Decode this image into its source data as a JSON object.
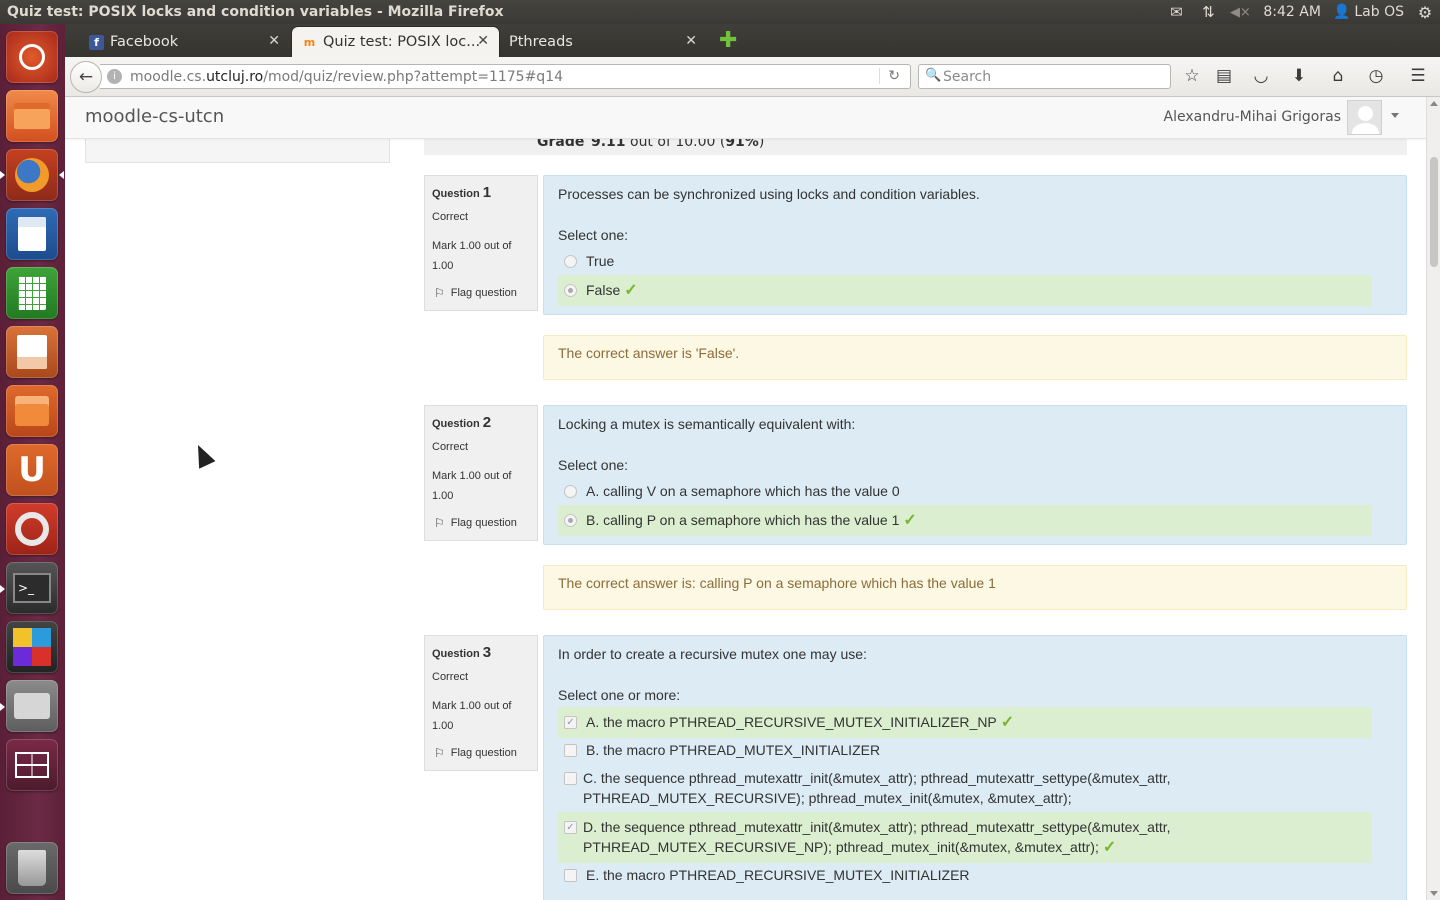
{
  "window": {
    "title": "Quiz test: POSIX locks and condition variables - Mozilla Firefox"
  },
  "system": {
    "clock": "8:42 AM",
    "user": "Lab OS",
    "icons": [
      "mail-icon",
      "network-icon",
      "volume-muted-icon",
      "gear-icon"
    ]
  },
  "launcher": {
    "items": [
      "ubuntu-dash",
      "files",
      "firefox",
      "libreoffice-writer",
      "libreoffice-calc",
      "libreoffice-impress",
      "software-center",
      "ubuntu-one",
      "system-settings",
      "terminal",
      "color-app",
      "printer-app",
      "workspace-switcher",
      "trash"
    ]
  },
  "tabs": [
    {
      "label": "Facebook",
      "favicon": "facebook-icon"
    },
    {
      "label": "Quiz test: POSIX loc...",
      "favicon": "moodle-icon"
    },
    {
      "label": "Pthreads",
      "favicon": ""
    }
  ],
  "urlbar": {
    "prefix": "moodle.cs.",
    "domain": "utcluj.ro",
    "path": "/mod/quiz/review.php?attempt=1175#q14"
  },
  "search": {
    "placeholder": "Search"
  },
  "moodle": {
    "brand": "moodle-cs-utcn",
    "user_name": "Alexandru-Mihai Grigoras"
  },
  "grade": {
    "label": "Grade",
    "value_bold": "9.11",
    "value_mid": " out of 10.00 (",
    "value_pct": "91%",
    "value_end": ")"
  },
  "questions": [
    {
      "label": "Question",
      "number": "1",
      "state": "Correct",
      "mark": "Mark 1.00 out of 1.00",
      "flag": "Flag question",
      "text": "Processes can be synchronized using locks and condition variables.",
      "prompt": "Select one:",
      "options": [
        {
          "text": "True",
          "selected": false,
          "correct": false
        },
        {
          "text": "False",
          "selected": true,
          "correct": true
        }
      ],
      "feedback": "The correct answer is 'False'."
    },
    {
      "label": "Question",
      "number": "2",
      "state": "Correct",
      "mark": "Mark 1.00 out of 1.00",
      "flag": "Flag question",
      "text": "Locking a mutex is semantically equivalent with:",
      "prompt": "Select one:",
      "options": [
        {
          "text": "A. calling V on a semaphore which has the value 0",
          "selected": false,
          "correct": false
        },
        {
          "text": "B. calling P on a semaphore which has the value 1",
          "selected": true,
          "correct": true
        }
      ],
      "feedback": "The correct answer is: calling P on a semaphore which has the value 1"
    },
    {
      "label": "Question",
      "number": "3",
      "state": "Correct",
      "mark": "Mark 1.00 out of 1.00",
      "flag": "Flag question",
      "text": "In order to create a recursive mutex one may use:",
      "prompt": "Select one or more:",
      "options": [
        {
          "text": "A. the macro PTHREAD_RECURSIVE_MUTEX_INITIALIZER_NP",
          "selected": true,
          "correct": true
        },
        {
          "text": "B. the macro PTHREAD_MUTEX_INITIALIZER",
          "selected": false,
          "correct": false
        },
        {
          "text": "C. the sequence pthread_mutexattr_init(&mutex_attr); pthread_mutexattr_settype(&mutex_attr, PTHREAD_MUTEX_RECURSIVE); pthread_mutex_init(&mutex, &mutex_attr);",
          "selected": false,
          "correct": false
        },
        {
          "text": "D. the sequence pthread_mutexattr_init(&mutex_attr); pthread_mutexattr_settype(&mutex_attr, PTHREAD_MUTEX_RECURSIVE_NP); pthread_mutex_init(&mutex, &mutex_attr);",
          "selected": true,
          "correct": true
        },
        {
          "text": "E. the macro PTHREAD_RECURSIVE_MUTEX_INITIALIZER",
          "selected": false,
          "correct": false
        }
      ]
    }
  ],
  "colors": {
    "launcher": "#5e2138",
    "question_bg": "#dcebf4",
    "correct_bg": "#dbefd0",
    "feedback_bg": "#fcf8e3",
    "feedback_text": "#8a6d3b",
    "tick": "#7ab32c"
  }
}
